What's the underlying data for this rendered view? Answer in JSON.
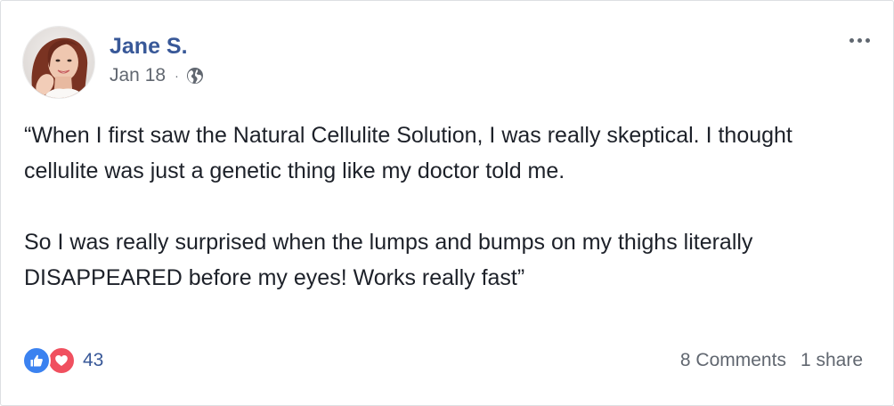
{
  "post": {
    "author": "Jane S.",
    "date": "Jan 18",
    "separator": "·",
    "privacy_icon": "globe-icon",
    "menu_icon": "more-options-icon",
    "paragraphs": [
      "“When I first saw the Natural Cellulite Solution, I was really skeptical. I thought cellulite was just a genetic thing like my doctor told me.",
      "So I was really surprised when the lumps and bumps on my thighs literally DISAPPEARED before my eyes! Works really fast”"
    ]
  },
  "footer": {
    "reaction_icons": [
      "like-icon",
      "love-icon"
    ],
    "reaction_count": "43",
    "comments": "8 Comments",
    "shares": "1 share"
  },
  "colors": {
    "author_link": "#385898",
    "meta_text": "#616770",
    "like": "#3b82f0",
    "love": "#f0505f"
  }
}
